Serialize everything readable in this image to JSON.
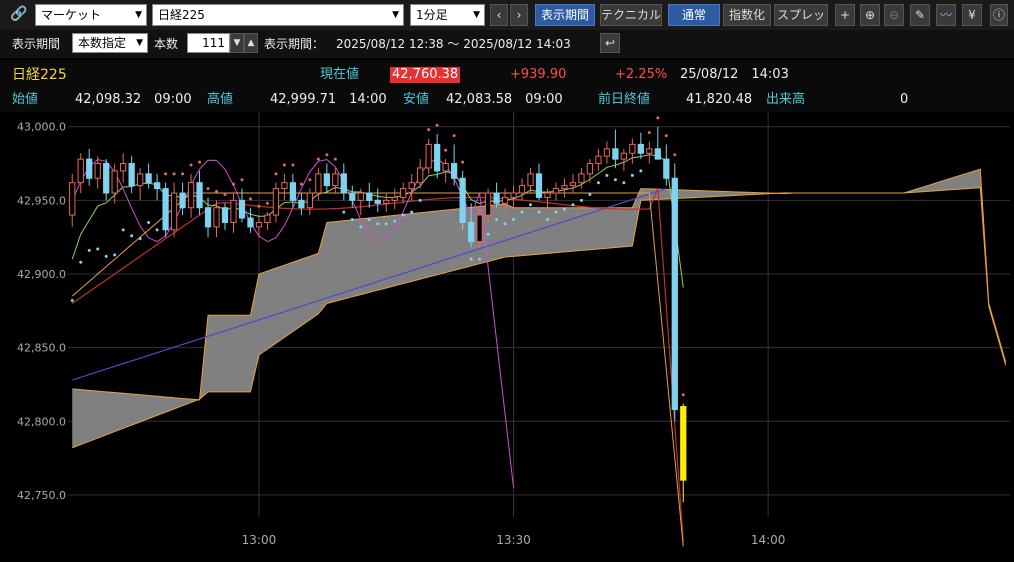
{
  "toolbar": {
    "market_select": "マーケット",
    "symbol_select": "日経225",
    "interval_select": "1分足",
    "period_button": "表示期間",
    "technical_button": "テクニカル",
    "normal_button": "通常",
    "index_button": "指数化",
    "spread_button": "スプレッド",
    "yen_button": "¥"
  },
  "period_bar": {
    "period_label": "表示期間",
    "period_mode": "本数指定",
    "count_label": "本数",
    "count_value": "111",
    "range_label": "表示期間：",
    "range_value": "2025/08/12 12:38 〜 2025/08/12 14:03"
  },
  "quote": {
    "name": "日経225",
    "current_label": "現在値",
    "current_value": "42,760.38",
    "change": "+939.90",
    "change_pct": "+2.25%",
    "datetime": "25/08/12　14:03",
    "open_label": "始値",
    "open_value": "42,098.32　09:00",
    "high_label": "高値",
    "high_value": "42,999.71　14:00",
    "low_label": "安値",
    "low_value": "42,083.58　09:00",
    "prev_label": "前日終値",
    "prev_value": "41,820.48",
    "volume_label": "出来高",
    "volume_value": "0"
  },
  "colors": {
    "bg": "#000000",
    "grid": "#333333",
    "up_candle": "#000000",
    "up_border": "#e8675a",
    "down_candle": "#7fd3f0",
    "last_candle": "#ffee00",
    "cloud": "#808080",
    "cloud_edge": "#e8a040",
    "sma_long": "#4a4ad0",
    "sma_mid": "#c03030",
    "sma_short": "#90d060",
    "rsi_like": "#d050d0",
    "psar_up": "#e8675a",
    "psar_down": "#7fd3f0"
  },
  "chart_data": {
    "type": "candlestick",
    "y_range": [
      42735,
      43010
    ],
    "y_ticks": [
      "43,000.0",
      "42,950.0",
      "42,900.0",
      "42,850.0",
      "42,800.0",
      "42,750.0"
    ],
    "y_tick_values": [
      43000,
      42950,
      42900,
      42850,
      42800,
      42750
    ],
    "x_ticks": [
      "13:00",
      "13:30",
      "14:00"
    ],
    "x_tick_index": [
      22,
      52,
      82
    ],
    "bar_count": 111,
    "candles": [
      {
        "o": 42940,
        "h": 42968,
        "l": 42932,
        "c": 42962
      },
      {
        "o": 42962,
        "h": 42982,
        "l": 42955,
        "c": 42978
      },
      {
        "o": 42978,
        "h": 42985,
        "l": 42960,
        "c": 42965
      },
      {
        "o": 42965,
        "h": 42980,
        "l": 42958,
        "c": 42975
      },
      {
        "o": 42975,
        "h": 42978,
        "l": 42950,
        "c": 42955
      },
      {
        "o": 42955,
        "h": 42975,
        "l": 42948,
        "c": 42970
      },
      {
        "o": 42970,
        "h": 42982,
        "l": 42962,
        "c": 42975
      },
      {
        "o": 42975,
        "h": 42980,
        "l": 42955,
        "c": 42960
      },
      {
        "o": 42960,
        "h": 42972,
        "l": 42950,
        "c": 42968
      },
      {
        "o": 42968,
        "h": 42975,
        "l": 42958,
        "c": 42962
      },
      {
        "o": 42962,
        "h": 42968,
        "l": 42950,
        "c": 42958
      },
      {
        "o": 42958,
        "h": 42962,
        "l": 42925,
        "c": 42930
      },
      {
        "o": 42930,
        "h": 42962,
        "l": 42925,
        "c": 42955
      },
      {
        "o": 42955,
        "h": 42962,
        "l": 42940,
        "c": 42945
      },
      {
        "o": 42945,
        "h": 42968,
        "l": 42938,
        "c": 42962
      },
      {
        "o": 42962,
        "h": 42970,
        "l": 42940,
        "c": 42945
      },
      {
        "o": 42945,
        "h": 42952,
        "l": 42925,
        "c": 42932
      },
      {
        "o": 42932,
        "h": 42950,
        "l": 42925,
        "c": 42945
      },
      {
        "o": 42945,
        "h": 42948,
        "l": 42930,
        "c": 42935
      },
      {
        "o": 42935,
        "h": 42955,
        "l": 42928,
        "c": 42950
      },
      {
        "o": 42950,
        "h": 42958,
        "l": 42935,
        "c": 42938
      },
      {
        "o": 42938,
        "h": 42945,
        "l": 42928,
        "c": 42932
      },
      {
        "o": 42932,
        "h": 42940,
        "l": 42925,
        "c": 42935
      },
      {
        "o": 42935,
        "h": 42942,
        "l": 42930,
        "c": 42940
      },
      {
        "o": 42940,
        "h": 42962,
        "l": 42935,
        "c": 42958
      },
      {
        "o": 42958,
        "h": 42968,
        "l": 42950,
        "c": 42962
      },
      {
        "o": 42962,
        "h": 42968,
        "l": 42945,
        "c": 42950
      },
      {
        "o": 42950,
        "h": 42955,
        "l": 42940,
        "c": 42945
      },
      {
        "o": 42945,
        "h": 42958,
        "l": 42940,
        "c": 42955
      },
      {
        "o": 42955,
        "h": 42972,
        "l": 42950,
        "c": 42968
      },
      {
        "o": 42968,
        "h": 42975,
        "l": 42955,
        "c": 42960
      },
      {
        "o": 42960,
        "h": 42972,
        "l": 42955,
        "c": 42968
      },
      {
        "o": 42968,
        "h": 42975,
        "l": 42950,
        "c": 42955
      },
      {
        "o": 42955,
        "h": 42960,
        "l": 42945,
        "c": 42950
      },
      {
        "o": 42950,
        "h": 42958,
        "l": 42940,
        "c": 42955
      },
      {
        "o": 42955,
        "h": 42962,
        "l": 42945,
        "c": 42950
      },
      {
        "o": 42950,
        "h": 42958,
        "l": 42942,
        "c": 42948
      },
      {
        "o": 42948,
        "h": 42955,
        "l": 42942,
        "c": 42950
      },
      {
        "o": 42950,
        "h": 42958,
        "l": 42944,
        "c": 42952
      },
      {
        "o": 42952,
        "h": 42962,
        "l": 42948,
        "c": 42958
      },
      {
        "o": 42958,
        "h": 42968,
        "l": 42950,
        "c": 42962
      },
      {
        "o": 42962,
        "h": 42978,
        "l": 42958,
        "c": 42972
      },
      {
        "o": 42972,
        "h": 42992,
        "l": 42968,
        "c": 42988
      },
      {
        "o": 42988,
        "h": 42995,
        "l": 42965,
        "c": 42970
      },
      {
        "o": 42970,
        "h": 42978,
        "l": 42962,
        "c": 42975
      },
      {
        "o": 42975,
        "h": 42988,
        "l": 42960,
        "c": 42965
      },
      {
        "o": 42965,
        "h": 42970,
        "l": 42930,
        "c": 42935
      },
      {
        "o": 42935,
        "h": 42948,
        "l": 42918,
        "c": 42922
      },
      {
        "o": 42922,
        "h": 42945,
        "l": 42918,
        "c": 42940
      },
      {
        "o": 42940,
        "h": 42958,
        "l": 42935,
        "c": 42955
      },
      {
        "o": 42955,
        "h": 42962,
        "l": 42945,
        "c": 42948
      },
      {
        "o": 42948,
        "h": 42958,
        "l": 42942,
        "c": 42952
      },
      {
        "o": 42952,
        "h": 42960,
        "l": 42945,
        "c": 42955
      },
      {
        "o": 42955,
        "h": 42965,
        "l": 42950,
        "c": 42960
      },
      {
        "o": 42960,
        "h": 42972,
        "l": 42955,
        "c": 42968
      },
      {
        "o": 42968,
        "h": 42975,
        "l": 42950,
        "c": 42952
      },
      {
        "o": 42952,
        "h": 42958,
        "l": 42945,
        "c": 42955
      },
      {
        "o": 42955,
        "h": 42962,
        "l": 42950,
        "c": 42958
      },
      {
        "o": 42958,
        "h": 42965,
        "l": 42952,
        "c": 42960
      },
      {
        "o": 42960,
        "h": 42968,
        "l": 42955,
        "c": 42962
      },
      {
        "o": 42962,
        "h": 42972,
        "l": 42958,
        "c": 42968
      },
      {
        "o": 42968,
        "h": 42978,
        "l": 42962,
        "c": 42975
      },
      {
        "o": 42975,
        "h": 42985,
        "l": 42970,
        "c": 42980
      },
      {
        "o": 42980,
        "h": 42990,
        "l": 42975,
        "c": 42985
      },
      {
        "o": 42985,
        "h": 42998,
        "l": 42972,
        "c": 42978
      },
      {
        "o": 42978,
        "h": 42985,
        "l": 42970,
        "c": 42982
      },
      {
        "o": 42982,
        "h": 42992,
        "l": 42975,
        "c": 42988
      },
      {
        "o": 42988,
        "h": 42996,
        "l": 42978,
        "c": 42982
      },
      {
        "o": 42982,
        "h": 42990,
        "l": 42975,
        "c": 42985
      },
      {
        "o": 42985,
        "h": 43000,
        "l": 42978,
        "c": 42978
      },
      {
        "o": 42978,
        "h": 42988,
        "l": 42960,
        "c": 42965
      },
      {
        "o": 42965,
        "h": 42975,
        "l": 42800,
        "c": 42808
      },
      {
        "o": 42810,
        "h": 42812,
        "l": 42745,
        "c": 42760
      }
    ],
    "series": [
      {
        "name": "雲上限",
        "values": []
      }
    ]
  }
}
